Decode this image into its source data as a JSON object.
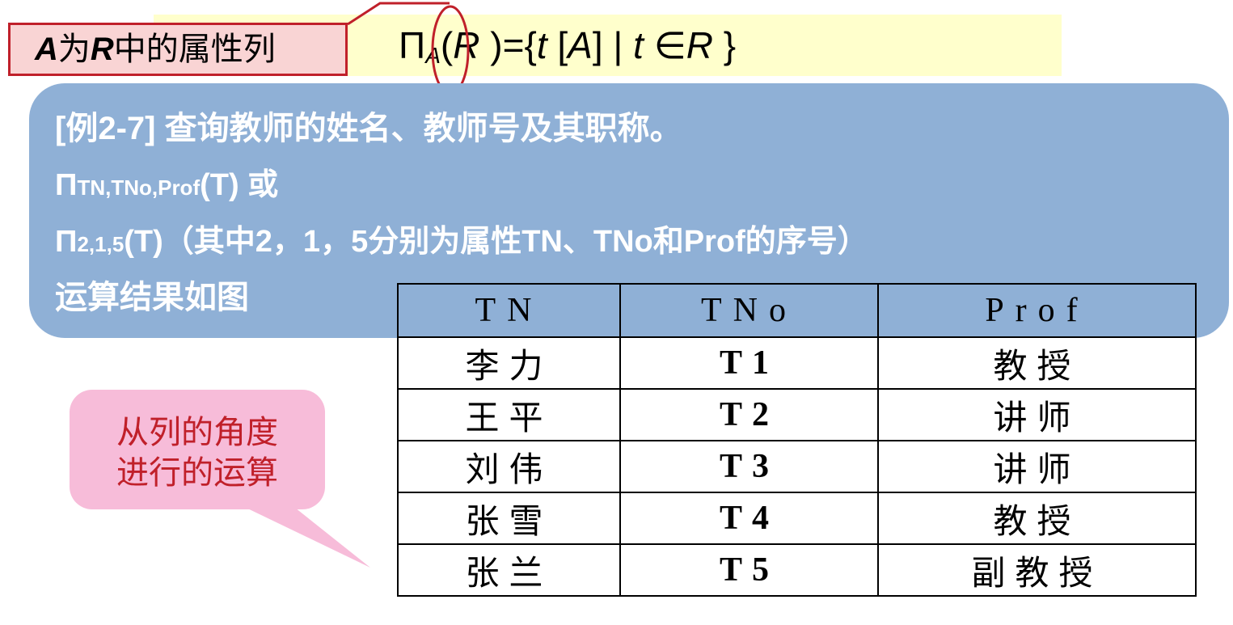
{
  "header": {
    "annotation_parts": [
      "A",
      "为",
      "R",
      "中的属性列"
    ],
    "formula_parts": [
      "Π",
      "A",
      "(",
      "R",
      " )={",
      "t",
      " [",
      "A",
      "] | ",
      "t",
      " ∈",
      "R",
      " }"
    ]
  },
  "example": {
    "line1": "[例2-7]  查询教师的姓名、教师号及其职称。",
    "line2_pi": "Π",
    "line2_sub": "TN,TNo,Prof",
    "line2_rest": "(T) 或",
    "line3_pi": "Π",
    "line3_sub": "2,1,5",
    "line3_rest": "(T)（其中2，1，5分别为属性TN、TNo和Prof的序号）",
    "line4": "运算结果如图"
  },
  "table": {
    "headers": [
      "TN",
      "TNo",
      "Prof"
    ],
    "rows": [
      [
        "李力",
        "T1",
        "教授"
      ],
      [
        "王平",
        "T2",
        "讲师"
      ],
      [
        "刘伟",
        "T3",
        "讲师"
      ],
      [
        "张雪",
        "T4",
        "教授"
      ],
      [
        "张兰",
        "T5",
        "副教授"
      ]
    ]
  },
  "callout": {
    "line1": "从列的角度",
    "line2": "进行的运算"
  },
  "colors": {
    "panel_blue": "#8fb0d6",
    "highlight_yellow": "#ffffcc",
    "accent_red": "#c0202a",
    "bubble_pink": "#f7bcd9"
  }
}
